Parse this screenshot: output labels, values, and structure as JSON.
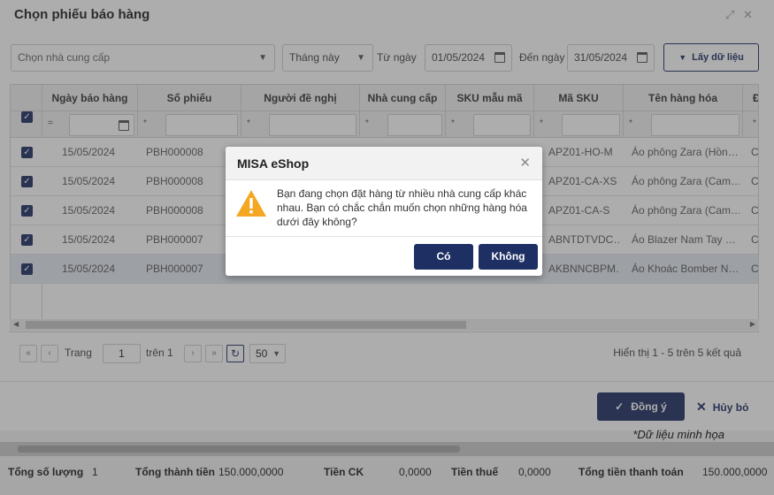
{
  "window": {
    "title": "Chọn phiếu báo hàng"
  },
  "filters": {
    "supplier_placeholder": "Chọn nhà cung cấp",
    "period": "Tháng này",
    "from_label": "Từ ngày",
    "from_value": "01/05/2024",
    "to_label": "Đến ngày",
    "to_value": "31/05/2024",
    "get_data_label": "Lấy dữ liệu"
  },
  "grid": {
    "columns": [
      "Ngày báo hàng",
      "Số phiếu",
      "Người đề nghị",
      "Nhà cung cấp",
      "SKU mẫu mã",
      "Mã SKU",
      "Tên hàng hóa",
      "Đ"
    ],
    "filter_ops": [
      "=",
      "*",
      "*",
      "*",
      "*",
      "*",
      "*",
      "*"
    ],
    "rows": [
      {
        "date": "15/05/2024",
        "no": "PBH000008",
        "sku": "APZ01-HO-M",
        "name": "Áo phông Zara (Hồn…",
        "d": "C"
      },
      {
        "date": "15/05/2024",
        "no": "PBH000008",
        "sku": "APZ01-CA-XS",
        "name": "Áo phông Zara (Cam…",
        "d": "C"
      },
      {
        "date": "15/05/2024",
        "no": "PBH000008",
        "sku": "APZ01-CA-S",
        "name": "Áo phông Zara (Cam…",
        "d": "C"
      },
      {
        "date": "15/05/2024",
        "no": "PBH000007",
        "sku": "ABNTDTVDC…",
        "name": "Áo Blazer Nam Tay …",
        "d": "C"
      },
      {
        "date": "15/05/2024",
        "no": "PBH000007",
        "sku": "AKBNNCBPM…",
        "name": "Áo Khoác Bomber N…",
        "d": "C"
      }
    ]
  },
  "pager": {
    "page_label": "Trang",
    "page_value": "1",
    "of_label": "trên 1",
    "page_size": "50",
    "info": "Hiển thị 1 - 5 trên 5 kết quả"
  },
  "actions": {
    "ok_label": "Đồng ý",
    "cancel_label": "Hủy bỏ"
  },
  "background": {
    "note": "*Dữ liệu minh họa",
    "summary": {
      "qty_label": "Tổng số lượng",
      "qty_value": "1",
      "amount_label": "Tổng thành tiền",
      "amount_value": "150.000,0000",
      "discount_label": "Tiền CK",
      "discount_value": "0,0000",
      "tax_label": "Tiền thuế",
      "tax_value": "0,0000",
      "pay_label": "Tổng tiền thanh toán",
      "pay_value": "150.000,0000"
    }
  },
  "dialog": {
    "title": "MISA eShop",
    "message": "Bạn đang chọn đặt hàng từ nhiều nhà cung cấp khác nhau. Bạn có chắc chắn muốn chọn những hàng hóa dưới đây không?",
    "yes_label": "Có",
    "no_label": "Không",
    "icon": "warning-icon",
    "accent": "#1e2f63",
    "warning_color": "#f5a623"
  }
}
